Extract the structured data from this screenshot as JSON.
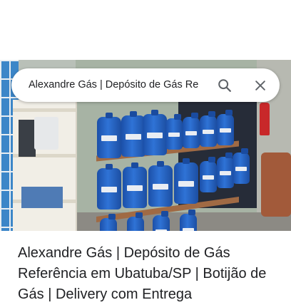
{
  "search": {
    "query": "Alexandre Gás | Depósito de Gás Re",
    "search_icon": "search-icon",
    "close_icon": "close-icon"
  },
  "photo": {
    "icon": "storefront-photo"
  },
  "result": {
    "title": "Alexandre Gás | Depósito de Gás Referência em Ubatuba/SP | Botijão de Gás | Delivery com Entrega"
  },
  "colors": {
    "icon_gray": "#5f6368",
    "text": "#202124",
    "jug_blue": "#2f73d6"
  }
}
